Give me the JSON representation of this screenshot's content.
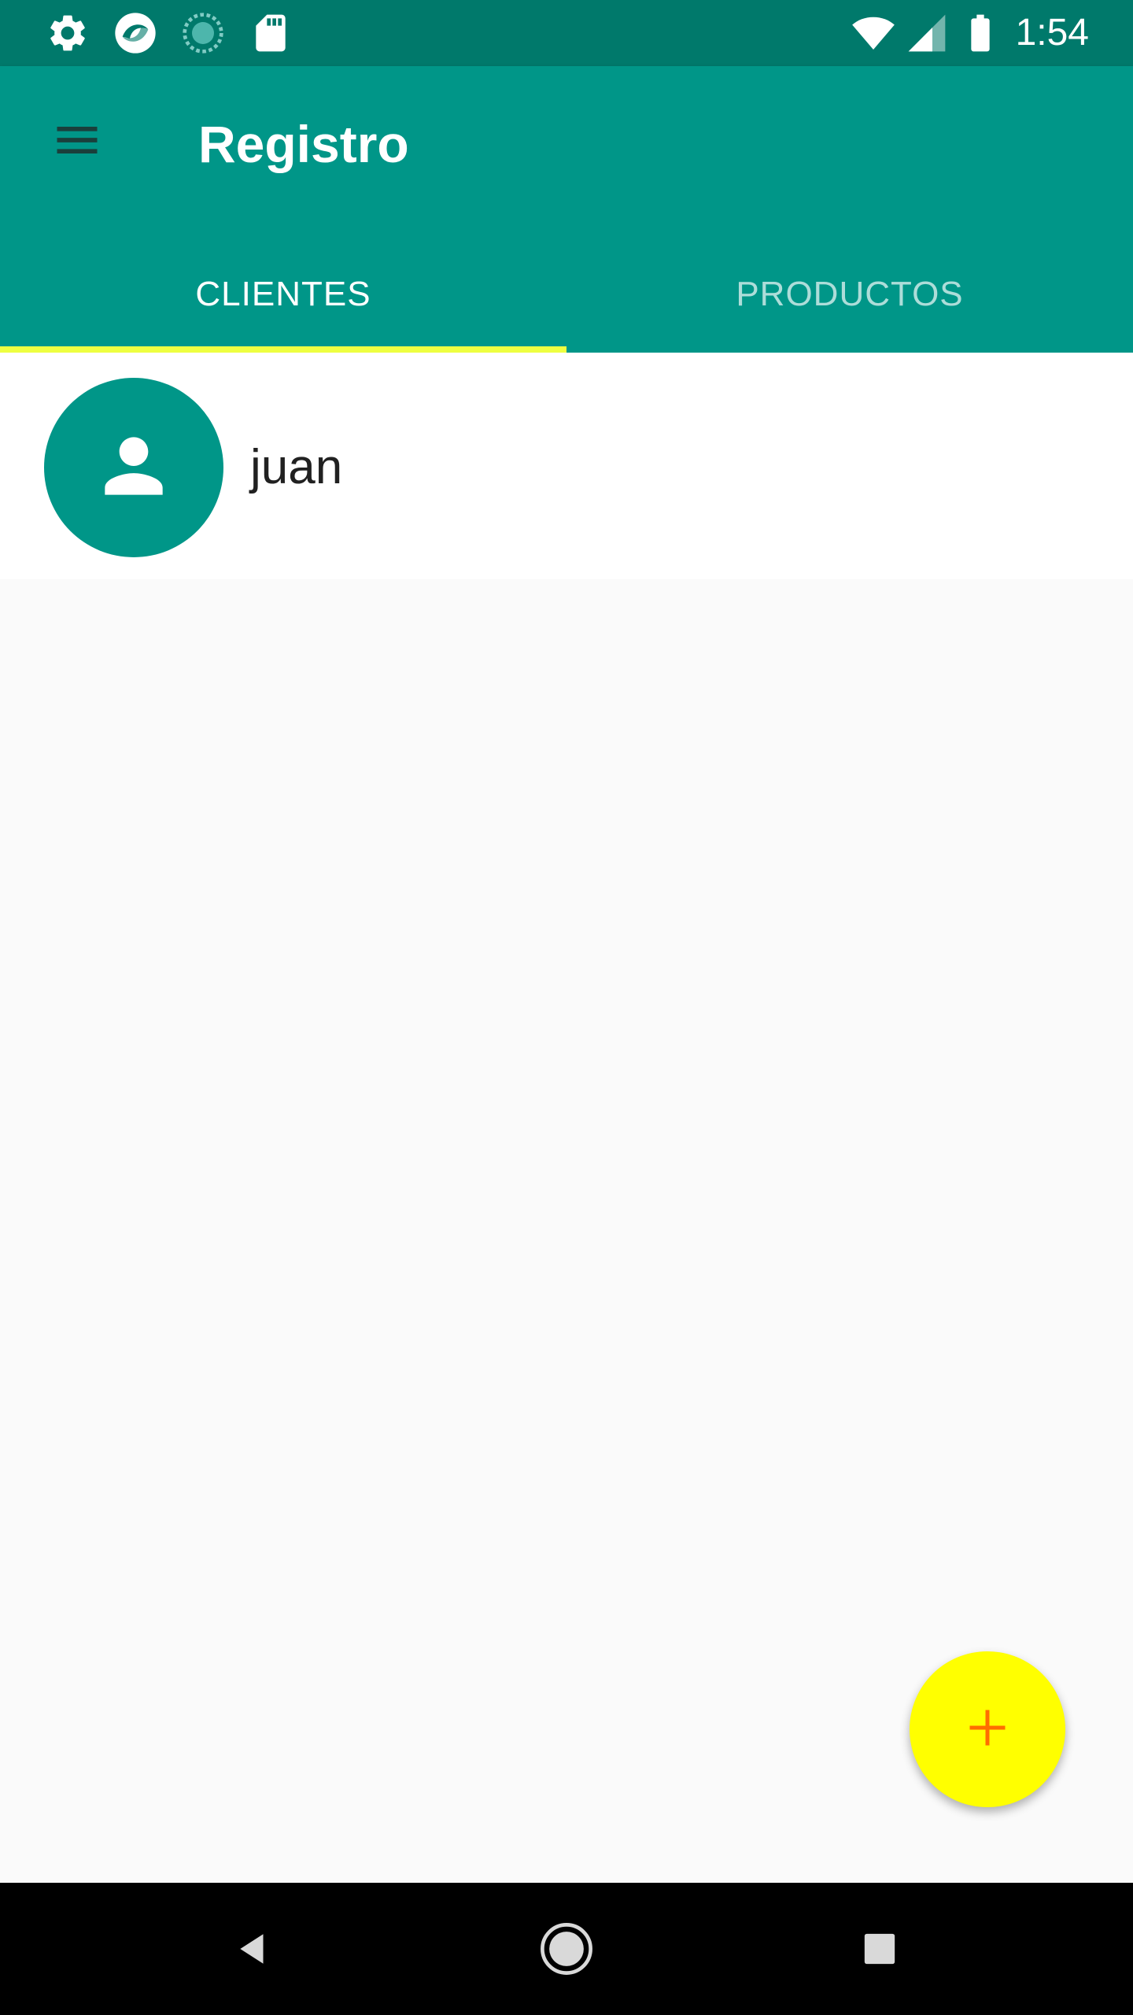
{
  "status_bar": {
    "time": "1:54",
    "left_icons": [
      "gear-icon",
      "app-logo-icon",
      "loading-icon",
      "sd-card-icon"
    ],
    "right_icons": [
      "wifi-icon",
      "cell-signal-icon",
      "battery-icon"
    ]
  },
  "app_bar": {
    "title": "Registro",
    "menu_icon": "hamburger-menu-icon"
  },
  "tabs": [
    {
      "label": "CLIENTES",
      "selected": true
    },
    {
      "label": "PRODUCTOS",
      "selected": false
    }
  ],
  "clients": [
    {
      "name": "juan",
      "icon": "person-icon"
    }
  ],
  "fab": {
    "icon": "plus-icon"
  },
  "nav_bar": {
    "icons": [
      "back-icon",
      "home-icon",
      "recents-icon"
    ]
  },
  "colors": {
    "status_bar": "#00796b",
    "primary": "#009688",
    "tab_indicator": "#eeff41",
    "fab_background": "#ffff00",
    "fab_icon": "#ff6d00",
    "background": "#fafafa",
    "nav_bar": "#000000"
  }
}
